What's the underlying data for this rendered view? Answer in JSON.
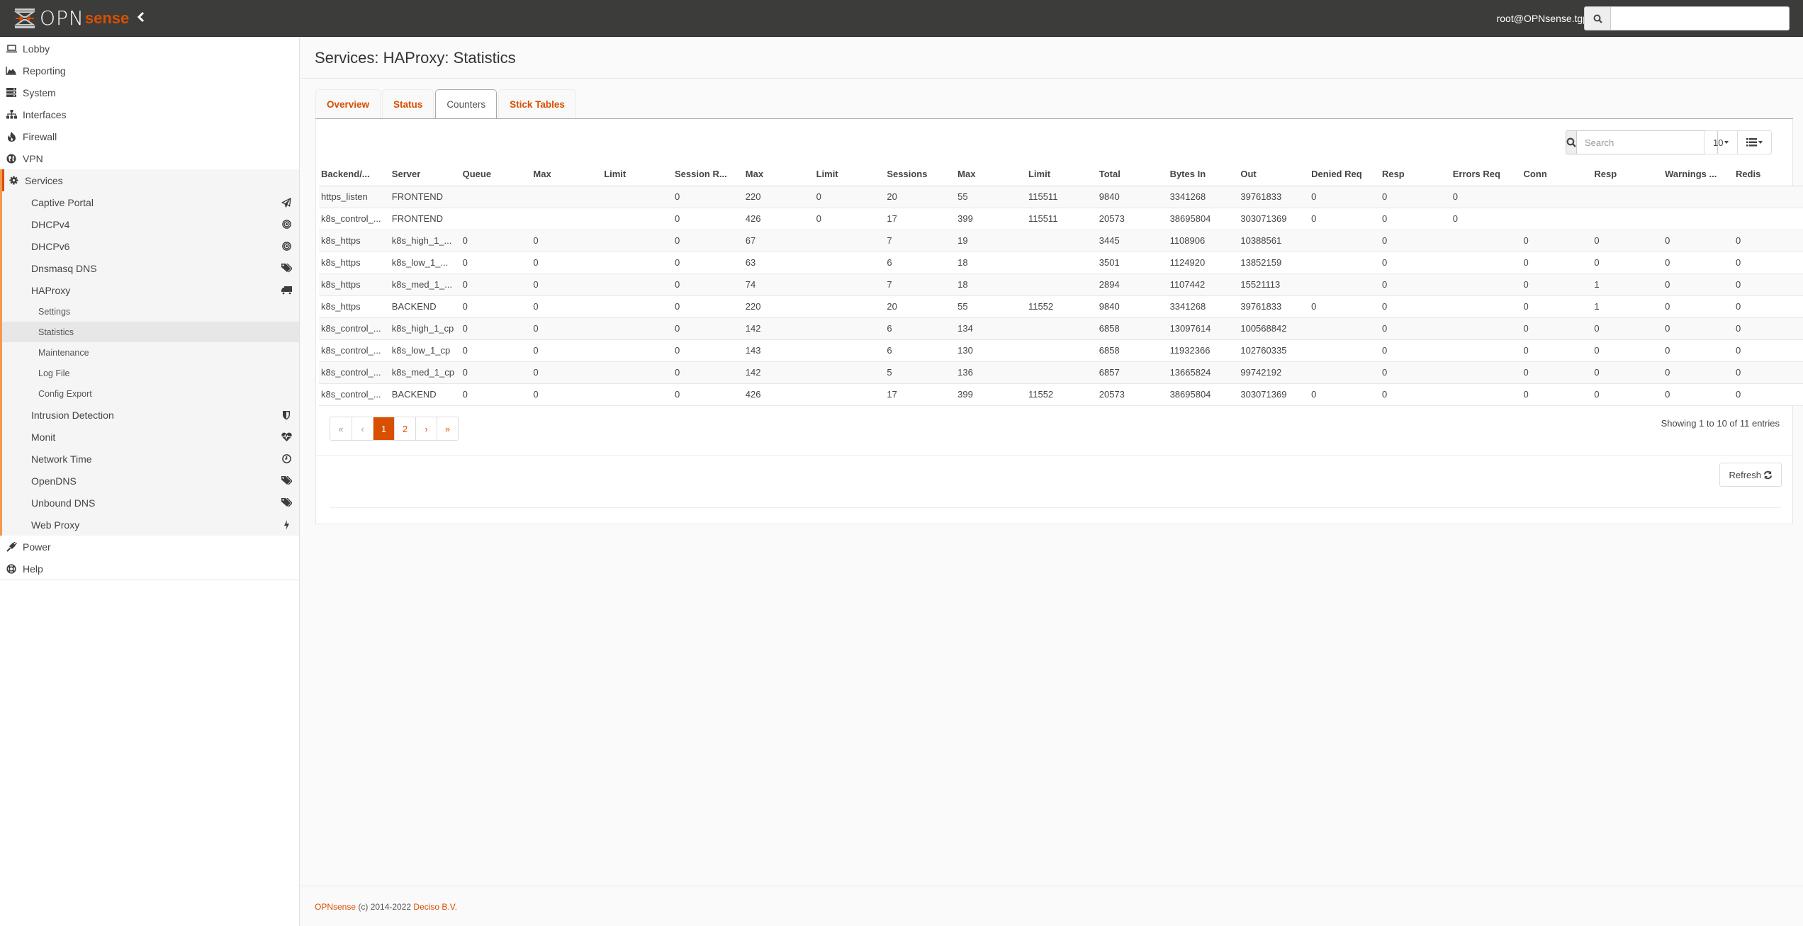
{
  "brand": {
    "logo_text": "OPN",
    "logo_accent": "sense",
    "accent_color": "#d94f00"
  },
  "navbar": {
    "user": "root@OPNsense.tgp",
    "search_value": "",
    "search_icon": "search-icon",
    "collapse_icon": "chevron-left-icon"
  },
  "sidebar": {
    "top_items": [
      {
        "label": "Lobby",
        "icon": "laptop-icon"
      },
      {
        "label": "Reporting",
        "icon": "area-chart-icon"
      },
      {
        "label": "System",
        "icon": "server-icon"
      },
      {
        "label": "Interfaces",
        "icon": "sitemap-icon"
      },
      {
        "label": "Firewall",
        "icon": "fire-icon"
      },
      {
        "label": "VPN",
        "icon": "globe-icon"
      }
    ],
    "services": {
      "label": "Services",
      "icon": "cog-icon",
      "items": [
        {
          "label": "Captive Portal",
          "icon": "paper-plane-icon"
        },
        {
          "label": "DHCPv4",
          "icon": "bullseye-icon"
        },
        {
          "label": "DHCPv6",
          "icon": "bullseye-icon"
        },
        {
          "label": "Dnsmasq DNS",
          "icon": "tags-icon"
        },
        {
          "label": "HAProxy",
          "icon": "truck-icon"
        }
      ],
      "haproxy_sub": [
        {
          "label": "Settings",
          "active": false
        },
        {
          "label": "Statistics",
          "active": true
        },
        {
          "label": "Maintenance",
          "active": false
        },
        {
          "label": "Log File",
          "active": false
        },
        {
          "label": "Config Export",
          "active": false
        }
      ],
      "items_after": [
        {
          "label": "Intrusion Detection",
          "icon": "shield-icon"
        },
        {
          "label": "Monit",
          "icon": "heartbeat-icon"
        },
        {
          "label": "Network Time",
          "icon": "clock-icon"
        },
        {
          "label": "OpenDNS",
          "icon": "tags-icon"
        },
        {
          "label": "Unbound DNS",
          "icon": "tags-icon"
        },
        {
          "label": "Web Proxy",
          "icon": "bolt-icon"
        }
      ]
    },
    "bottom_items": [
      {
        "label": "Power",
        "icon": "plug-icon"
      },
      {
        "label": "Help",
        "icon": "life-ring-icon"
      }
    ]
  },
  "page": {
    "title": "Services: HAProxy: Statistics",
    "tabs": [
      {
        "label": "Overview",
        "active": false
      },
      {
        "label": "Status",
        "active": false
      },
      {
        "label": "Counters",
        "active": true
      },
      {
        "label": "Stick Tables",
        "active": false
      }
    ]
  },
  "grid": {
    "search_placeholder": "Search",
    "search_value": "",
    "page_size": "10",
    "columns_icon": "list-icon",
    "columns": [
      "Backend/...",
      "Server",
      "Queue",
      "Max",
      "Limit",
      "Session R...",
      "Max",
      "Limit",
      "Sessions",
      "Max",
      "Limit",
      "Total",
      "Bytes In",
      "Out",
      "Denied Req",
      "Resp",
      "Errors Req",
      "Conn",
      "Resp",
      "Warnings ...",
      "Redis"
    ],
    "rows": [
      [
        "https_listen",
        "FRONTEND",
        "",
        "",
        "",
        "0",
        "220",
        "0",
        "20",
        "55",
        "115511",
        "9840",
        "3341268",
        "39761833",
        "0",
        "0",
        "0",
        "",
        "",
        "",
        ""
      ],
      [
        "k8s_control_...",
        "FRONTEND",
        "",
        "",
        "",
        "0",
        "426",
        "0",
        "17",
        "399",
        "115511",
        "20573",
        "38695804",
        "303071369",
        "0",
        "0",
        "0",
        "",
        "",
        "",
        ""
      ],
      [
        "k8s_https",
        "k8s_high_1_...",
        "0",
        "0",
        "",
        "0",
        "67",
        "",
        "7",
        "19",
        "",
        "3445",
        "1108906",
        "10388561",
        "",
        "0",
        "",
        "0",
        "0",
        "0",
        "0"
      ],
      [
        "k8s_https",
        "k8s_low_1_...",
        "0",
        "0",
        "",
        "0",
        "63",
        "",
        "6",
        "18",
        "",
        "3501",
        "1124920",
        "13852159",
        "",
        "0",
        "",
        "0",
        "0",
        "0",
        "0"
      ],
      [
        "k8s_https",
        "k8s_med_1_...",
        "0",
        "0",
        "",
        "0",
        "74",
        "",
        "7",
        "18",
        "",
        "2894",
        "1107442",
        "15521113",
        "",
        "0",
        "",
        "0",
        "1",
        "0",
        "0"
      ],
      [
        "k8s_https",
        "BACKEND",
        "0",
        "0",
        "",
        "0",
        "220",
        "",
        "20",
        "55",
        "11552",
        "9840",
        "3341268",
        "39761833",
        "0",
        "0",
        "",
        "0",
        "1",
        "0",
        "0"
      ],
      [
        "k8s_control_...",
        "k8s_high_1_cp",
        "0",
        "0",
        "",
        "0",
        "142",
        "",
        "6",
        "134",
        "",
        "6858",
        "13097614",
        "100568842",
        "",
        "0",
        "",
        "0",
        "0",
        "0",
        "0"
      ],
      [
        "k8s_control_...",
        "k8s_low_1_cp",
        "0",
        "0",
        "",
        "0",
        "143",
        "",
        "6",
        "130",
        "",
        "6858",
        "11932366",
        "102760335",
        "",
        "0",
        "",
        "0",
        "0",
        "0",
        "0"
      ],
      [
        "k8s_control_...",
        "k8s_med_1_cp",
        "0",
        "0",
        "",
        "0",
        "142",
        "",
        "5",
        "136",
        "",
        "6857",
        "13665824",
        "99742192",
        "",
        "0",
        "",
        "0",
        "0",
        "0",
        "0"
      ],
      [
        "k8s_control_...",
        "BACKEND",
        "0",
        "0",
        "",
        "0",
        "426",
        "",
        "17",
        "399",
        "11552",
        "20573",
        "38695804",
        "303071369",
        "0",
        "0",
        "",
        "0",
        "0",
        "0",
        "0"
      ]
    ],
    "pagination": [
      {
        "label": "«",
        "state": "disabled"
      },
      {
        "label": "‹",
        "state": "disabled"
      },
      {
        "label": "1",
        "state": "active"
      },
      {
        "label": "2",
        "state": "normal"
      },
      {
        "label": "›",
        "state": "normal"
      },
      {
        "label": "»",
        "state": "normal"
      }
    ],
    "showing": "Showing 1 to 10 of 11 entries",
    "refresh_label": "Refresh"
  },
  "footer": {
    "brand_link": "OPNsense",
    "copyright": " (c) 2014-2022 ",
    "company_link": "Deciso B.V."
  }
}
